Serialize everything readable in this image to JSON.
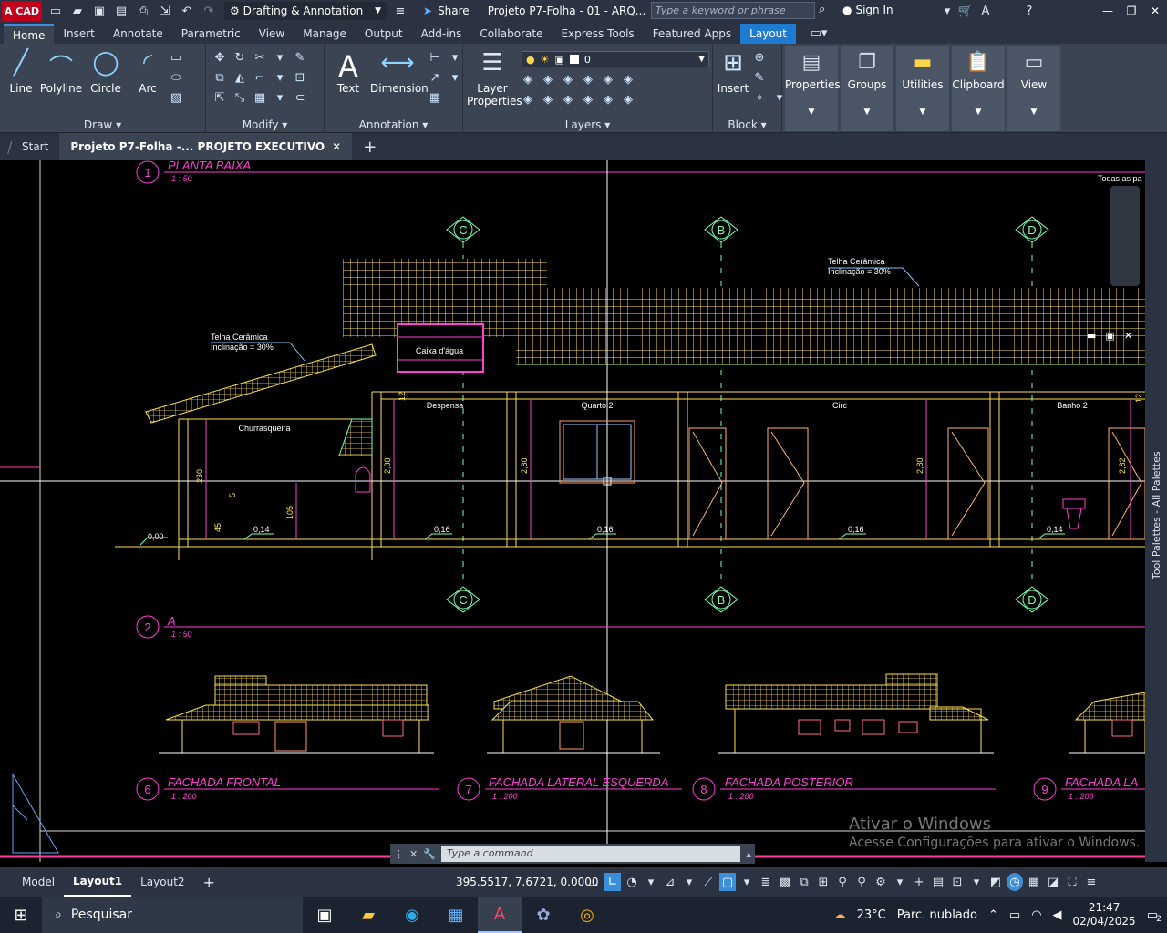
{
  "titlebar": {
    "logo_text": "A CAD",
    "workspace": "Drafting & Annotation",
    "share": "Share",
    "doc_title": "Projeto P7-Folha - 01 - ARQ...",
    "search_placeholder": "Type a keyword or phrase",
    "sign_in": "Sign In"
  },
  "ribbon_tabs": [
    "Home",
    "Insert",
    "Annotate",
    "Parametric",
    "View",
    "Manage",
    "Output",
    "Add-ins",
    "Collaborate",
    "Express Tools",
    "Featured Apps",
    "Layout"
  ],
  "ribbon": {
    "draw": {
      "label": "Draw",
      "line": "Line",
      "polyline": "Polyline",
      "circle": "Circle",
      "arc": "Arc"
    },
    "modify": {
      "label": "Modify"
    },
    "annotation": {
      "label": "Annotation",
      "text": "Text",
      "dimension": "Dimension"
    },
    "layers": {
      "label": "Layers",
      "layer_properties": "Layer\nProperties",
      "current_layer": "0"
    },
    "block": {
      "label": "Block",
      "insert": "Insert"
    },
    "properties": "Properties",
    "groups": "Groups",
    "utilities": "Utilities",
    "clipboard": "Clipboard",
    "view": "View"
  },
  "file_tabs": {
    "start": "Start",
    "active": "Projeto P7-Folha -... PROJETO EXECUTIVO"
  },
  "drawing": {
    "plan_title": "PLANTA BAIXA",
    "plan_num": "1",
    "plan_scale": "1 : 50",
    "section_title": "A",
    "section_num": "2",
    "section_scale": "1 : 50",
    "grid_c": "C",
    "grid_b": "B",
    "grid_d": "D",
    "roof_note_left_1": "Telha Cerâmica",
    "roof_note_left_2": "Inclinação = 30%",
    "roof_note_right_1": "Telha Cerâmica",
    "roof_note_right_2": "Inclinação = 30%",
    "caixa": "Caixa d'água",
    "rooms": [
      "Churrasqueira",
      "Despensa",
      "Quarto 2",
      "Circ",
      "Banho 2"
    ],
    "dims": {
      "d000": "0,00",
      "d014a": "0,14",
      "d016a": "0,16",
      "d016b": "0,16",
      "d016c": "0,16",
      "d014b": "0,14",
      "d230": "230",
      "d280a": "2,80",
      "d280b": "2,80",
      "d280c": "2,80",
      "d282": "2,82",
      "d105": "105",
      "d45": "45",
      "d5": "5",
      "d12a": "12",
      "d12b": "12"
    },
    "facades": [
      {
        "num": "6",
        "title": "FACHADA FRONTAL",
        "scale": "1 : 200"
      },
      {
        "num": "7",
        "title": "FACHADA LATERAL ESQUERDA",
        "scale": "1 : 200"
      },
      {
        "num": "8",
        "title": "FACHADA POSTERIOR",
        "scale": "1 : 200"
      },
      {
        "num": "9",
        "title": "FACHADA LA",
        "scale": "1 : 200"
      }
    ],
    "corner_text": "Todas as pa"
  },
  "side_palette": "Tool Palettes - All Palettes",
  "command": {
    "placeholder": "Type a command"
  },
  "watermark": {
    "line1": "Ativar o Windows",
    "line2": "Acesse Configurações para ativar o Windows."
  },
  "status": {
    "model": "Model",
    "layout1": "Layout1",
    "layout2": "Layout2",
    "coords": "395.5517, 7.6721, 0.0000"
  },
  "taskbar": {
    "search": "Pesquisar",
    "temp": "23°C",
    "weather": "Parc. nublado",
    "time": "21:47",
    "date": "02/04/2025",
    "notif": "2"
  }
}
